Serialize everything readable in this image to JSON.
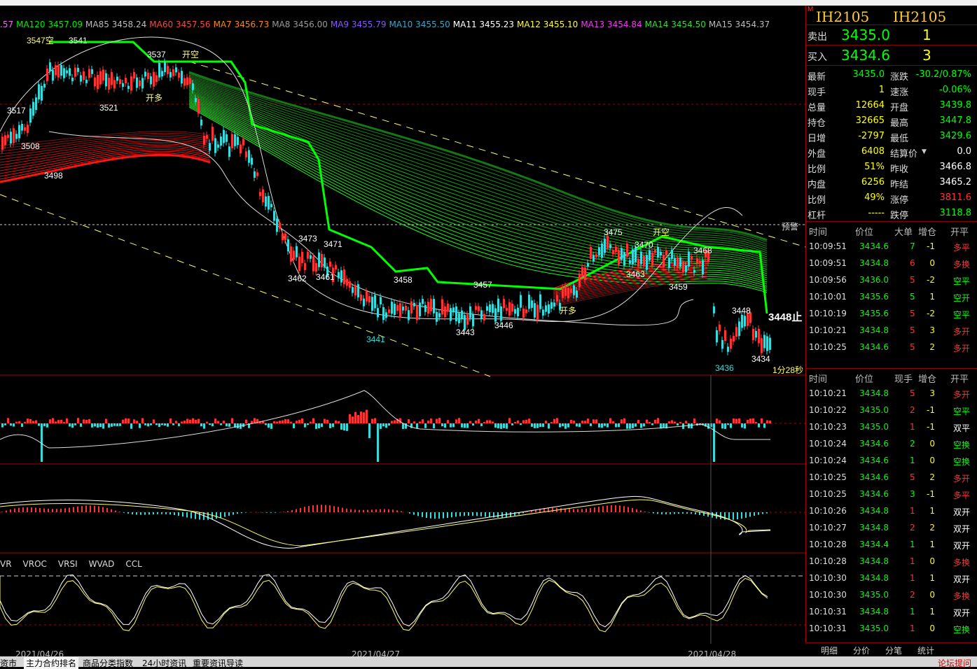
{
  "ma_labels": [
    {
      "text": ".57",
      "color": "#ff66ff"
    },
    {
      "text": "MA120 3457.09",
      "color": "#00ee00"
    },
    {
      "text": "MA85 3458.24",
      "color": "#bbbbbb"
    },
    {
      "text": "MA60 3457.56",
      "color": "#ff4444"
    },
    {
      "text": "MA7 3456.73",
      "color": "#ff8800"
    },
    {
      "text": "MA8 3456.00",
      "color": "#999999"
    },
    {
      "text": "MA9 3455.79",
      "color": "#8855ff"
    },
    {
      "text": "MA10 3455.50",
      "color": "#33aacc"
    },
    {
      "text": "MA11 3455.23",
      "color": "#ffffff"
    },
    {
      "text": "MA12 3455.10",
      "color": "#ffff33"
    },
    {
      "text": "MA13 3454.84",
      "color": "#ff33ff"
    },
    {
      "text": "MA14 3454.50",
      "color": "#33dd33"
    },
    {
      "text": "MA15 3454.37",
      "color": "#bbbbbb"
    }
  ],
  "price_labels": [
    "3547空",
    "3541",
    "3537",
    "开空",
    "3517",
    "3521",
    "开多",
    "3508",
    "3498",
    "3473",
    "3471",
    "3462",
    "3461",
    "3458",
    "3457",
    "3443",
    "3446",
    "3441",
    "3475",
    "3470",
    "开空",
    "3468",
    "3463",
    "3459",
    "3448",
    "3434",
    "3436",
    "开多",
    "预警",
    "1分28秒",
    "3448止"
  ],
  "indicator_tabs": [
    "VR",
    "VROC",
    "VRSI",
    "WVAD",
    "CCL"
  ],
  "dates": [
    "2021/04/26",
    "2021/04/27",
    "2021/04/28"
  ],
  "panel": {
    "symbol": "IH2105",
    "symbol2": "IH2105",
    "ask_label": "卖出",
    "ask_price": "3435.0",
    "ask_vol": "1",
    "bid_label": "买入",
    "bid_price": "3434.6",
    "bid_vol": "3",
    "quote_rows": [
      {
        "l1": "最新",
        "v1": "3435.0",
        "c1": "#00ff00",
        "l2": "涨跌",
        "v2": "-30.2/0.87%",
        "c2": "#00ff00"
      },
      {
        "l1": "现手",
        "v1": "1",
        "c1": "#ffff00",
        "l2": "速涨",
        "v2": "-0.06%",
        "c2": "#00ff00"
      },
      {
        "l1": "总量",
        "v1": "12664",
        "c1": "#ffff00",
        "l2": "开盘",
        "v2": "3439.8",
        "c2": "#00ff00"
      },
      {
        "l1": "持仓",
        "v1": "32665",
        "c1": "#ffff00",
        "l2": "最高",
        "v2": "3447.8",
        "c2": "#00ff00"
      },
      {
        "l1": "日增",
        "v1": "-2797",
        "c1": "#ffff00",
        "l2": "最低",
        "v2": "3429.6",
        "c2": "#00ff00"
      },
      {
        "l1": "外盘",
        "v1": "6408",
        "c1": "#ffff00",
        "l2": "结算价",
        "v2": "0.0",
        "c2": "#ffffff"
      },
      {
        "l1": "比例",
        "v1": "51%",
        "c1": "#ffff00",
        "l2": "昨收",
        "v2": "3466.8",
        "c2": "#ffffff"
      },
      {
        "l1": "内盘",
        "v1": "6256",
        "c1": "#ffff00",
        "l2": "昨结",
        "v2": "3465.2",
        "c2": "#ffffff"
      },
      {
        "l1": "比例",
        "v1": "49%",
        "c1": "#ffff00",
        "l2": "涨停",
        "v2": "3811.6",
        "c2": "#ff3333"
      },
      {
        "l1": "杠杆",
        "v1": "-----",
        "c1": "#ffff00",
        "l2": "跌停",
        "v2": "3118.8",
        "c2": "#00ff00"
      }
    ],
    "list1_headers": [
      "时间",
      "价位",
      "大单",
      "增仓",
      "开平"
    ],
    "list1": [
      {
        "t": "10:09:51",
        "p": "3434.6",
        "pc": "#00ff00",
        "v": "7",
        "vc": "#00ff00",
        "d": "-1",
        "k": "多平",
        "kc": "#ff3333"
      },
      {
        "t": "10:09:51",
        "p": "3434.8",
        "pc": "#00ff00",
        "v": "6",
        "vc": "#ff3333",
        "d": "0",
        "k": "多换",
        "kc": "#ff3333"
      },
      {
        "t": "10:09:56",
        "p": "3436.0",
        "pc": "#00ff00",
        "v": "5",
        "vc": "#ff3333",
        "d": "-2",
        "k": "空平",
        "kc": "#00ff00"
      },
      {
        "t": "10:10:01",
        "p": "3435.6",
        "pc": "#00ff00",
        "v": "5",
        "vc": "#00ff00",
        "d": "1",
        "k": "空开",
        "kc": "#00ff00"
      },
      {
        "t": "10:10:19",
        "p": "3435.6",
        "pc": "#00ff00",
        "v": "5",
        "vc": "#ff3333",
        "d": "-2",
        "k": "空平",
        "kc": "#00ff00"
      },
      {
        "t": "10:10:21",
        "p": "3434.8",
        "pc": "#00ff00",
        "v": "5",
        "vc": "#ff3333",
        "d": "3",
        "k": "多开",
        "kc": "#ff3333"
      },
      {
        "t": "10:10:25",
        "p": "3434.6",
        "pc": "#00ff00",
        "v": "5",
        "vc": "#ff3333",
        "d": "2",
        "k": "多开",
        "kc": "#ff3333"
      }
    ],
    "list2_headers": [
      "时间",
      "价位",
      "现手",
      "增仓",
      "开平"
    ],
    "list2": [
      {
        "t": "10:10:21",
        "p": "3434.8",
        "pc": "#00ff00",
        "v": "5",
        "vc": "#ff3333",
        "d": "3",
        "k": "多开",
        "kc": "#ff3333"
      },
      {
        "t": "10:10:22",
        "p": "3435.0",
        "pc": "#00ff00",
        "v": "2",
        "vc": "#ff3333",
        "d": "-1",
        "k": "空平",
        "kc": "#00ff00"
      },
      {
        "t": "10:10:23",
        "p": "3435.0",
        "pc": "#00ff00",
        "v": "1",
        "vc": "#ff3333",
        "d": "-1",
        "k": "双平",
        "kc": "#ffffff"
      },
      {
        "t": "10:10:24",
        "p": "3434.6",
        "pc": "#00ff00",
        "v": "2",
        "vc": "#00ff00",
        "d": "0",
        "k": "空换",
        "kc": "#00ff00"
      },
      {
        "t": "10:10:24",
        "p": "3434.6",
        "pc": "#00ff00",
        "v": "1",
        "vc": "#00ff00",
        "d": "0",
        "k": "空换",
        "kc": "#00ff00"
      },
      {
        "t": "10:10:25",
        "p": "3434.6",
        "pc": "#00ff00",
        "v": "5",
        "vc": "#ff3333",
        "d": "2",
        "k": "多开",
        "kc": "#ff3333"
      },
      {
        "t": "10:10:25",
        "p": "3434.6",
        "pc": "#00ff00",
        "v": "3",
        "vc": "#00ff00",
        "d": "-1",
        "k": "多平",
        "kc": "#ff3333"
      },
      {
        "t": "10:10:26",
        "p": "3434.8",
        "pc": "#00ff00",
        "v": "1",
        "vc": "#ff3333",
        "d": "1",
        "k": "双开",
        "kc": "#ffffff"
      },
      {
        "t": "10:10:27",
        "p": "3434.8",
        "pc": "#00ff00",
        "v": "2",
        "vc": "#ff3333",
        "d": "2",
        "k": "双开",
        "kc": "#ffffff"
      },
      {
        "t": "10:10:28",
        "p": "3434.4",
        "pc": "#00ff00",
        "v": "1",
        "vc": "#00ff00",
        "d": "1",
        "k": "双开",
        "kc": "#ffffff"
      },
      {
        "t": "10:10:28",
        "p": "3434.8",
        "pc": "#00ff00",
        "v": "1",
        "vc": "#ff3333",
        "d": "0",
        "k": "多换",
        "kc": "#ff3333"
      },
      {
        "t": "10:10:30",
        "p": "3434.8",
        "pc": "#00ff00",
        "v": "1",
        "vc": "#ff3333",
        "d": "1",
        "k": "双开",
        "kc": "#ffffff"
      },
      {
        "t": "10:10:30",
        "p": "3435.0",
        "pc": "#00ff00",
        "v": "2",
        "vc": "#ff3333",
        "d": "0",
        "k": "多换",
        "kc": "#ff3333"
      },
      {
        "t": "10:10:31",
        "p": "3434.8",
        "pc": "#00ff00",
        "v": "1",
        "vc": "#00ff00",
        "d": "1",
        "k": "双开",
        "kc": "#ffffff"
      },
      {
        "t": "10:10:31",
        "p": "3435.0",
        "pc": "#00ff00",
        "v": "1",
        "vc": "#ff3333",
        "d": "0",
        "k": "空换",
        "kc": "#00ff00"
      }
    ],
    "tabs": [
      "明细",
      "分价",
      "分笔",
      "统计"
    ]
  },
  "bottom_tabs": [
    "资市",
    "主力合约排名",
    "商品分类指数",
    "24小时资讯",
    "重要资讯导读"
  ],
  "bottom_right": "论坛提问"
}
